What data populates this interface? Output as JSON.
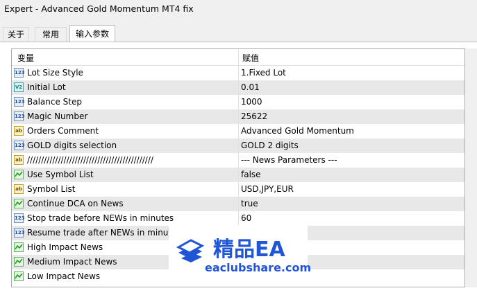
{
  "window": {
    "title": "Expert - Advanced Gold Momentum MT4 fix"
  },
  "tabs": [
    {
      "label": "关于"
    },
    {
      "label": "常用"
    },
    {
      "label": "输入参数"
    }
  ],
  "grid": {
    "headers": {
      "variable": "变量",
      "value": "赋值"
    },
    "rows": [
      {
        "icon": "int-type-icon",
        "icon_text": "123",
        "name": "Lot Size Style",
        "value": "1.Fixed Lot"
      },
      {
        "icon": "double-type-icon",
        "icon_text": "V2",
        "name": "Initial Lot",
        "value": "0.01"
      },
      {
        "icon": "int-type-icon",
        "icon_text": "123",
        "name": "Balance Step",
        "value": "1000"
      },
      {
        "icon": "int-type-icon",
        "icon_text": "123",
        "name": "Magic Number",
        "value": "25622"
      },
      {
        "icon": "string-type-icon",
        "icon_text": "ab",
        "name": "Orders Comment",
        "value": "Advanced Gold Momentum"
      },
      {
        "icon": "int-type-icon",
        "icon_text": "123",
        "name": "GOLD digits selection",
        "value": "GOLD 2 digits"
      },
      {
        "icon": "string-type-icon",
        "icon_text": "ab",
        "name": "/////////////////////////////////////////////",
        "value": "--- News Parameters ---"
      },
      {
        "icon": "bool-type-icon",
        "icon_text": "",
        "name": "Use Symbol List",
        "value": "false"
      },
      {
        "icon": "string-type-icon",
        "icon_text": "ab",
        "name": "Symbol List",
        "value": "USD,JPY,EUR"
      },
      {
        "icon": "bool-type-icon",
        "icon_text": "",
        "name": "Continue DCA on News",
        "value": "true"
      },
      {
        "icon": "int-type-icon",
        "icon_text": "123",
        "name": "Stop trade before NEWs in minutes",
        "value": "60"
      },
      {
        "icon": "int-type-icon",
        "icon_text": "123",
        "name": "Resume trade after NEWs in minute",
        "value": ""
      },
      {
        "icon": "bool-type-icon",
        "icon_text": "",
        "name": "High Impact News",
        "value": ""
      },
      {
        "icon": "bool-type-icon",
        "icon_text": "",
        "name": "Medium Impact News",
        "value": ""
      },
      {
        "icon": "bool-type-icon",
        "icon_text": "",
        "name": "Low Impact News",
        "value": ""
      }
    ]
  },
  "watermark": {
    "cn": "精品EA",
    "url": "eaclubshare.com"
  },
  "colors": {
    "brand": "#1f55d6",
    "row_alt": "#e8e8e8"
  }
}
